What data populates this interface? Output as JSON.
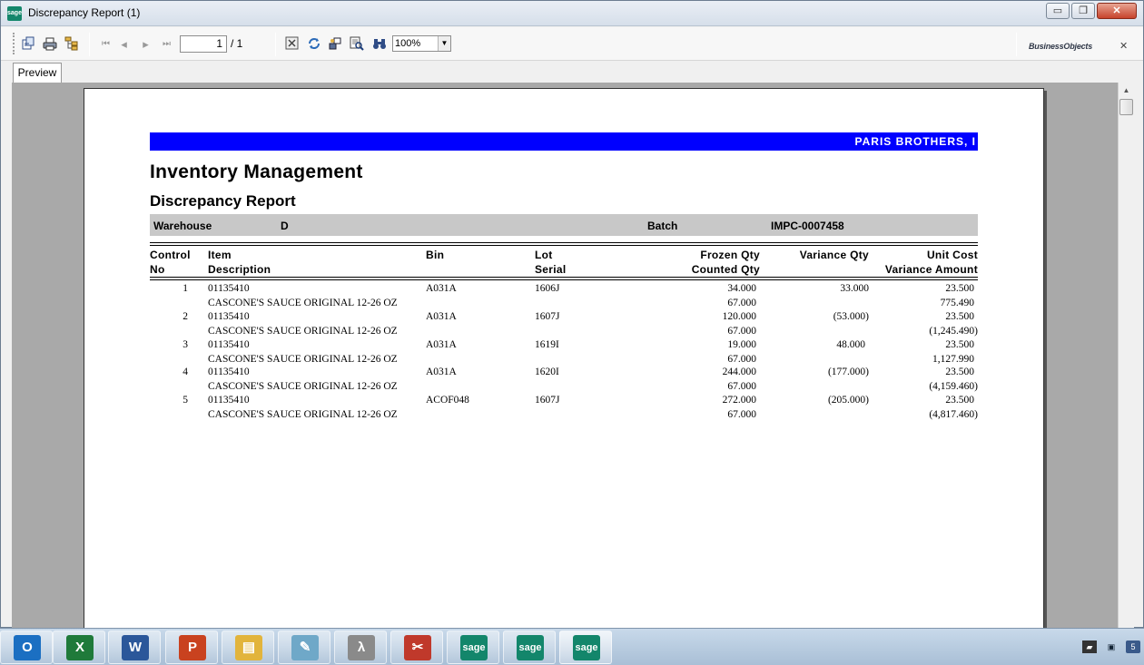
{
  "window": {
    "title": "Discrepancy Report (1)",
    "app_icon_text": "sage",
    "minimize_glyph": "▭",
    "restore_glyph": "❐",
    "close_glyph": "✕"
  },
  "toolbar": {
    "export_icon": "export-icon",
    "print_icon": "print-icon",
    "group_tree_icon": "group-tree-icon",
    "first_glyph": "⏮",
    "prev_glyph": "◂",
    "next_glyph": "▸",
    "last_glyph": "⏭",
    "current_page": "1",
    "total_pages": "/ 1",
    "zoom": "100%",
    "brand": "BusinessObjects",
    "close_glyph": "✕"
  },
  "tabs": [
    {
      "label": "Preview"
    }
  ],
  "report": {
    "company_banner": "PARIS BROTHERS, I",
    "title": "Inventory Management",
    "subtitle": "Discrepancy Report",
    "warehouse_label": "Warehouse",
    "warehouse_value": "D",
    "batch_label": "Batch",
    "batch_value": "IMPC-0007458",
    "columns": {
      "control": "Control",
      "no": "No",
      "item": "Item",
      "description": "Description",
      "bin": "Bin",
      "lot": "Lot",
      "serial": "Serial",
      "frozen_qty": "Frozen Qty",
      "counted_qty": "Counted Qty",
      "variance_qty": "Variance Qty",
      "unit_cost": "Unit Cost",
      "variance_amount": "Variance Amount"
    },
    "rows": [
      {
        "no": "1",
        "item": "01135410",
        "bin": "A031A",
        "lot": "1606J",
        "frozen": "34.000",
        "variance": "33.000",
        "unit_cost": "23.500",
        "description": "CASCONE'S SAUCE ORIGINAL 12-26 OZ",
        "counted": "67.000",
        "amount": "775.490"
      },
      {
        "no": "2",
        "item": "01135410",
        "bin": "A031A",
        "lot": "1607J",
        "frozen": "120.000",
        "variance": "(53.000)",
        "unit_cost": "23.500",
        "description": "CASCONE'S SAUCE ORIGINAL 12-26 OZ",
        "counted": "67.000",
        "amount": "(1,245.490)"
      },
      {
        "no": "3",
        "item": "01135410",
        "bin": "A031A",
        "lot": "1619I",
        "frozen": "19.000",
        "variance": "48.000",
        "unit_cost": "23.500",
        "description": "CASCONE'S SAUCE ORIGINAL 12-26 OZ",
        "counted": "67.000",
        "amount": "1,127.990"
      },
      {
        "no": "4",
        "item": "01135410",
        "bin": "A031A",
        "lot": "1620I",
        "frozen": "244.000",
        "variance": "(177.000)",
        "unit_cost": "23.500",
        "description": "CASCONE'S SAUCE ORIGINAL 12-26 OZ",
        "counted": "67.000",
        "amount": "(4,159.460)"
      },
      {
        "no": "5",
        "item": "01135410",
        "bin": "ACOF048",
        "lot": "1607J",
        "frozen": "272.000",
        "variance": "(205.000)",
        "unit_cost": "23.500",
        "description": "CASCONE'S SAUCE ORIGINAL 12-26 OZ",
        "counted": "67.000",
        "amount": "(4,817.460)"
      }
    ]
  },
  "taskbar": {
    "apps": [
      {
        "name": "outlook-icon",
        "glyph": "O",
        "color": "#1b6fc2"
      },
      {
        "name": "excel-icon",
        "glyph": "X",
        "color": "#1f7a3a"
      },
      {
        "name": "word-icon",
        "glyph": "W",
        "color": "#2b579a"
      },
      {
        "name": "powerpoint-icon",
        "glyph": "P",
        "color": "#c9421f"
      },
      {
        "name": "explorer-icon",
        "glyph": "▤",
        "color": "#e2b43c"
      },
      {
        "name": "notepad-icon",
        "glyph": "✎",
        "color": "#6fa8c8"
      },
      {
        "name": "calculator-icon",
        "glyph": "λ",
        "color": "#8a8a8a"
      },
      {
        "name": "snipping-tool-icon",
        "glyph": "✂",
        "color": "#c0392b"
      },
      {
        "name": "sage-icon",
        "glyph": "sage",
        "color": "#13866b"
      },
      {
        "name": "sage-icon",
        "glyph": "sage",
        "color": "#13866b"
      },
      {
        "name": "sage-icon",
        "glyph": "sage",
        "color": "#13866b"
      }
    ],
    "tray": [
      {
        "name": "network-icon",
        "glyph": "▰"
      },
      {
        "name": "monitor-icon",
        "glyph": "▣"
      },
      {
        "name": "app-tray-icon",
        "glyph": "5"
      }
    ]
  }
}
